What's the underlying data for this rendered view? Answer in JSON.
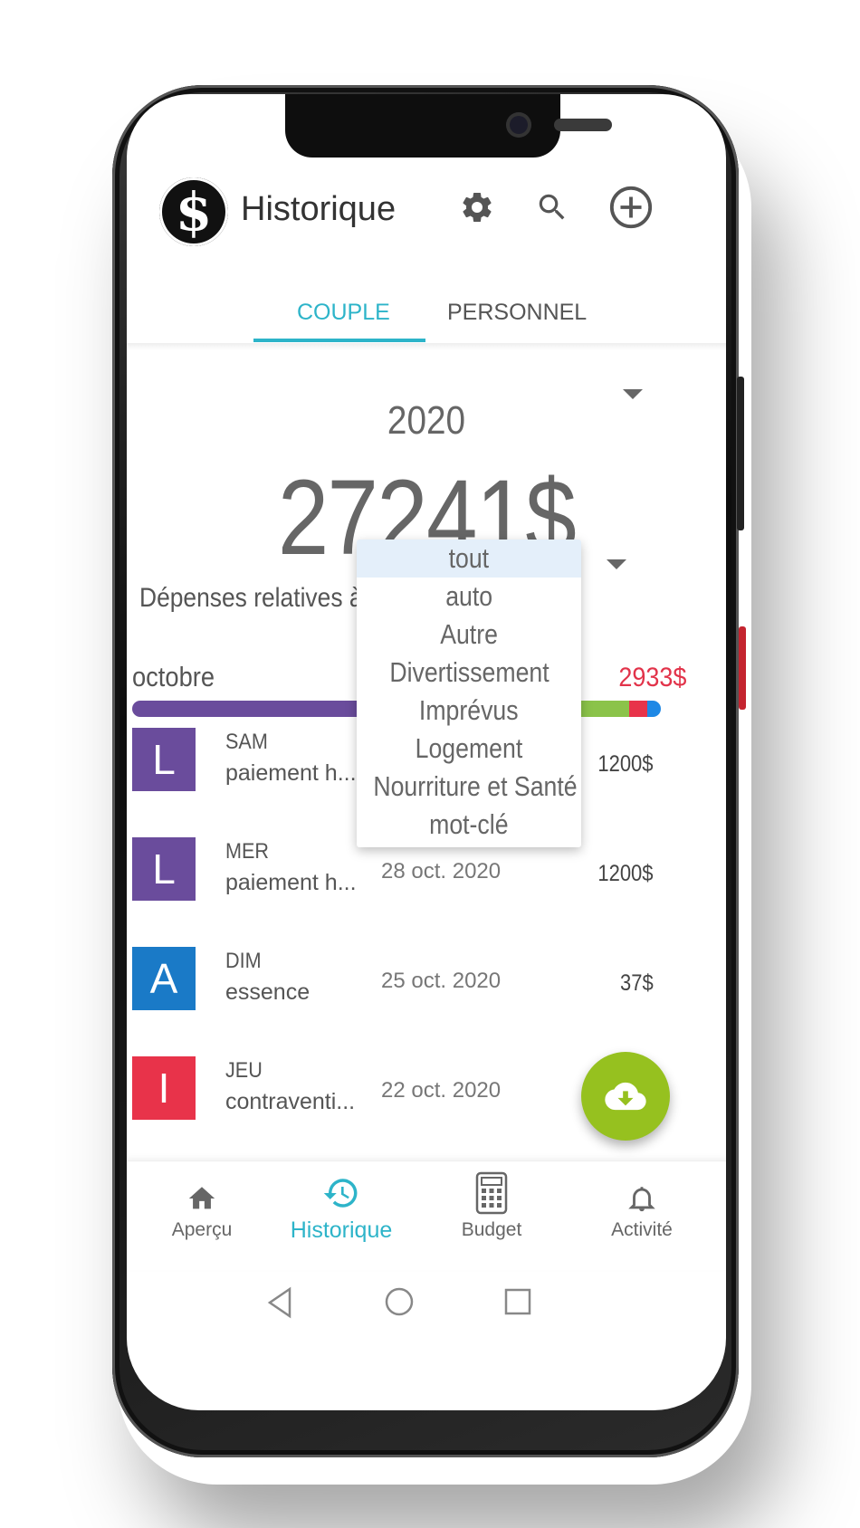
{
  "app": {
    "logo_text": "$",
    "title": "Historique"
  },
  "header_icons": [
    "gear-icon",
    "search-icon",
    "add-circle-icon"
  ],
  "tabs": [
    {
      "label": "COUPLE",
      "active": true
    },
    {
      "label": "PERSONNEL",
      "active": false
    }
  ],
  "summary": {
    "year": "2020",
    "total": "27241$"
  },
  "filter": {
    "label": "Dépenses relatives à",
    "options": [
      "tout",
      "auto",
      "Autre",
      "Divertissement",
      "Imprévus",
      "Logement",
      "Nourriture et Santé",
      "mot-clé"
    ],
    "selected": "tout"
  },
  "month": {
    "name": "octobre",
    "total": "2933$",
    "breakdown_colors": [
      "#6a4c9c",
      "#8bc34a",
      "#e8334a",
      "#1e88e5"
    ]
  },
  "transactions": [
    {
      "initial": "L",
      "color": "#6a4c9c",
      "day": "SAM",
      "description": "paiement h...",
      "date": "",
      "amount": "1200$"
    },
    {
      "initial": "L",
      "color": "#6a4c9c",
      "day": "MER",
      "description": "paiement h...",
      "date": "28 oct. 2020",
      "amount": "1200$"
    },
    {
      "initial": "A",
      "color": "#1a7ac7",
      "day": "DIM",
      "description": "essence",
      "date": "25 oct. 2020",
      "amount": "37$"
    },
    {
      "initial": "I",
      "color": "#e8334a",
      "day": "JEU",
      "description": "contraventi...",
      "date": "22 oct. 2020",
      "amount": ""
    }
  ],
  "fab_icon": "cloud-download-icon",
  "accent_color": "#2db4c9",
  "fab_color": "#96c11f",
  "bottom_nav": [
    {
      "label": "Aperçu",
      "icon": "home-icon",
      "active": false
    },
    {
      "label": "Historique",
      "icon": "history-icon",
      "active": true
    },
    {
      "label": "Budget",
      "icon": "calculator-icon",
      "active": false
    },
    {
      "label": "Activité",
      "icon": "bell-icon",
      "active": false
    }
  ],
  "system_nav": [
    "back-icon",
    "home-circle-icon",
    "recents-icon"
  ]
}
